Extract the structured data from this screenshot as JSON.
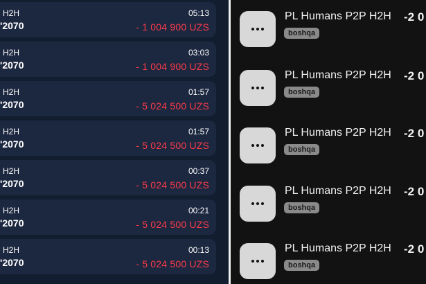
{
  "transactions": [
    {
      "name": "H2H",
      "account": "'2070",
      "time": "05:13",
      "amount": "- 1 004 900 UZS"
    },
    {
      "name": "H2H",
      "account": "'2070",
      "time": "03:03",
      "amount": "- 1 004 900 UZS"
    },
    {
      "name": "H2H",
      "account": "'2070",
      "time": "01:57",
      "amount": "- 5 024 500 UZS"
    },
    {
      "name": "H2H",
      "account": "'2070",
      "time": "01:57",
      "amount": "- 5 024 500 UZS"
    },
    {
      "name": "H2H",
      "account": "'2070",
      "time": "00:37",
      "amount": "- 5 024 500 UZS"
    },
    {
      "name": "H2H",
      "account": "'2070",
      "time": "00:21",
      "amount": "- 5 024 500 UZS"
    },
    {
      "name": "H2H",
      "account": "'2070",
      "time": "00:13",
      "amount": "- 5 024 500 UZS"
    }
  ],
  "operations": [
    {
      "title": "PL Humans P2P H2H",
      "tag": "boshqa",
      "amount": "-2 0",
      "icon": "more-dots-icon"
    },
    {
      "title": "PL Humans P2P H2H",
      "tag": "boshqa",
      "amount": "-2 0",
      "icon": "more-dots-icon"
    },
    {
      "title": "PL Humans P2P H2H",
      "tag": "boshqa",
      "amount": "-2 0",
      "icon": "more-dots-icon"
    },
    {
      "title": "PL Humans P2P H2H",
      "tag": "boshqa",
      "amount": "-2 0",
      "icon": "more-dots-icon"
    },
    {
      "title": "PL Humans P2P H2H",
      "tag": "boshqa",
      "amount": "-2 0",
      "icon": "more-dots-icon"
    }
  ],
  "colors": {
    "debit_amount": "#ff3a4a",
    "left_background": "#121d30",
    "right_background": "#121212"
  }
}
